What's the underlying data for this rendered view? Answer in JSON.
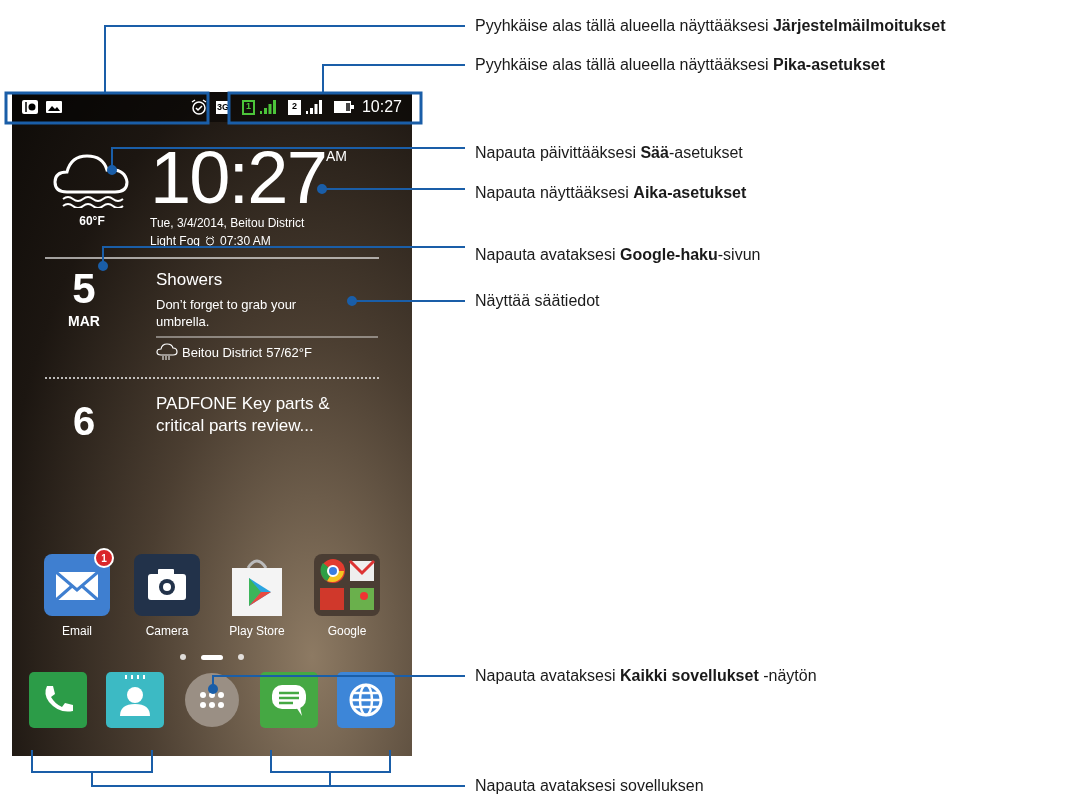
{
  "callouts": [
    {
      "text": "Pyyhkäise alas tällä alueella näyttääksesi **Järjestelmäilmoitukset**"
    },
    {
      "text": "Pyyhkäise alas tällä alueella näyttääksesi **Pika-asetukset**"
    },
    {
      "text": "Napauta päivittääksesi **Sää**-asetukset"
    },
    {
      "text": "Napauta näyttääksesi **Aika-asetukset**"
    },
    {
      "text": "Napauta avataksesi **Google-haku**-sivun"
    },
    {
      "text": "Näyttää säätiedot"
    },
    {
      "text": "Napauta avataksesi **Kaikki sovellukset** -näytön"
    },
    {
      "text": "Napauta avataksesi sovelluksen"
    }
  ],
  "status_bar": {
    "network": "3G",
    "sims": [
      {
        "label": "1",
        "active": true
      },
      {
        "label": "2",
        "active": false
      }
    ],
    "time": "10:27"
  },
  "weather": {
    "temperature": "60°F"
  },
  "clock": {
    "time": "10:27",
    "meridiem": "AM",
    "date_line": "Tue, 3/4/2014, Beitou District",
    "condition": "Light Fog",
    "alarm": "07:30 AM"
  },
  "agenda": [
    {
      "day": "5",
      "month": "MAR",
      "title": "Showers",
      "note": "Don’t forget to grab your umbrella.",
      "location": "Beitou District",
      "temps": "57/62°F"
    },
    {
      "day": "6",
      "title": "PADFONE Key parts & critical parts review..."
    }
  ],
  "apps": [
    {
      "kind": "email",
      "label": "Email",
      "badge": "1"
    },
    {
      "kind": "camera",
      "label": "Camera"
    },
    {
      "kind": "store",
      "label": "Play Store"
    },
    {
      "kind": "folder",
      "label": "Google"
    }
  ],
  "pages": [
    {
      "selected": false
    },
    {
      "selected": true
    },
    {
      "selected": false
    }
  ],
  "dock": [
    {
      "kind": "phone"
    },
    {
      "kind": "contacts"
    },
    {
      "kind": "all_apps"
    },
    {
      "kind": "messages"
    },
    {
      "kind": "browser"
    }
  ]
}
